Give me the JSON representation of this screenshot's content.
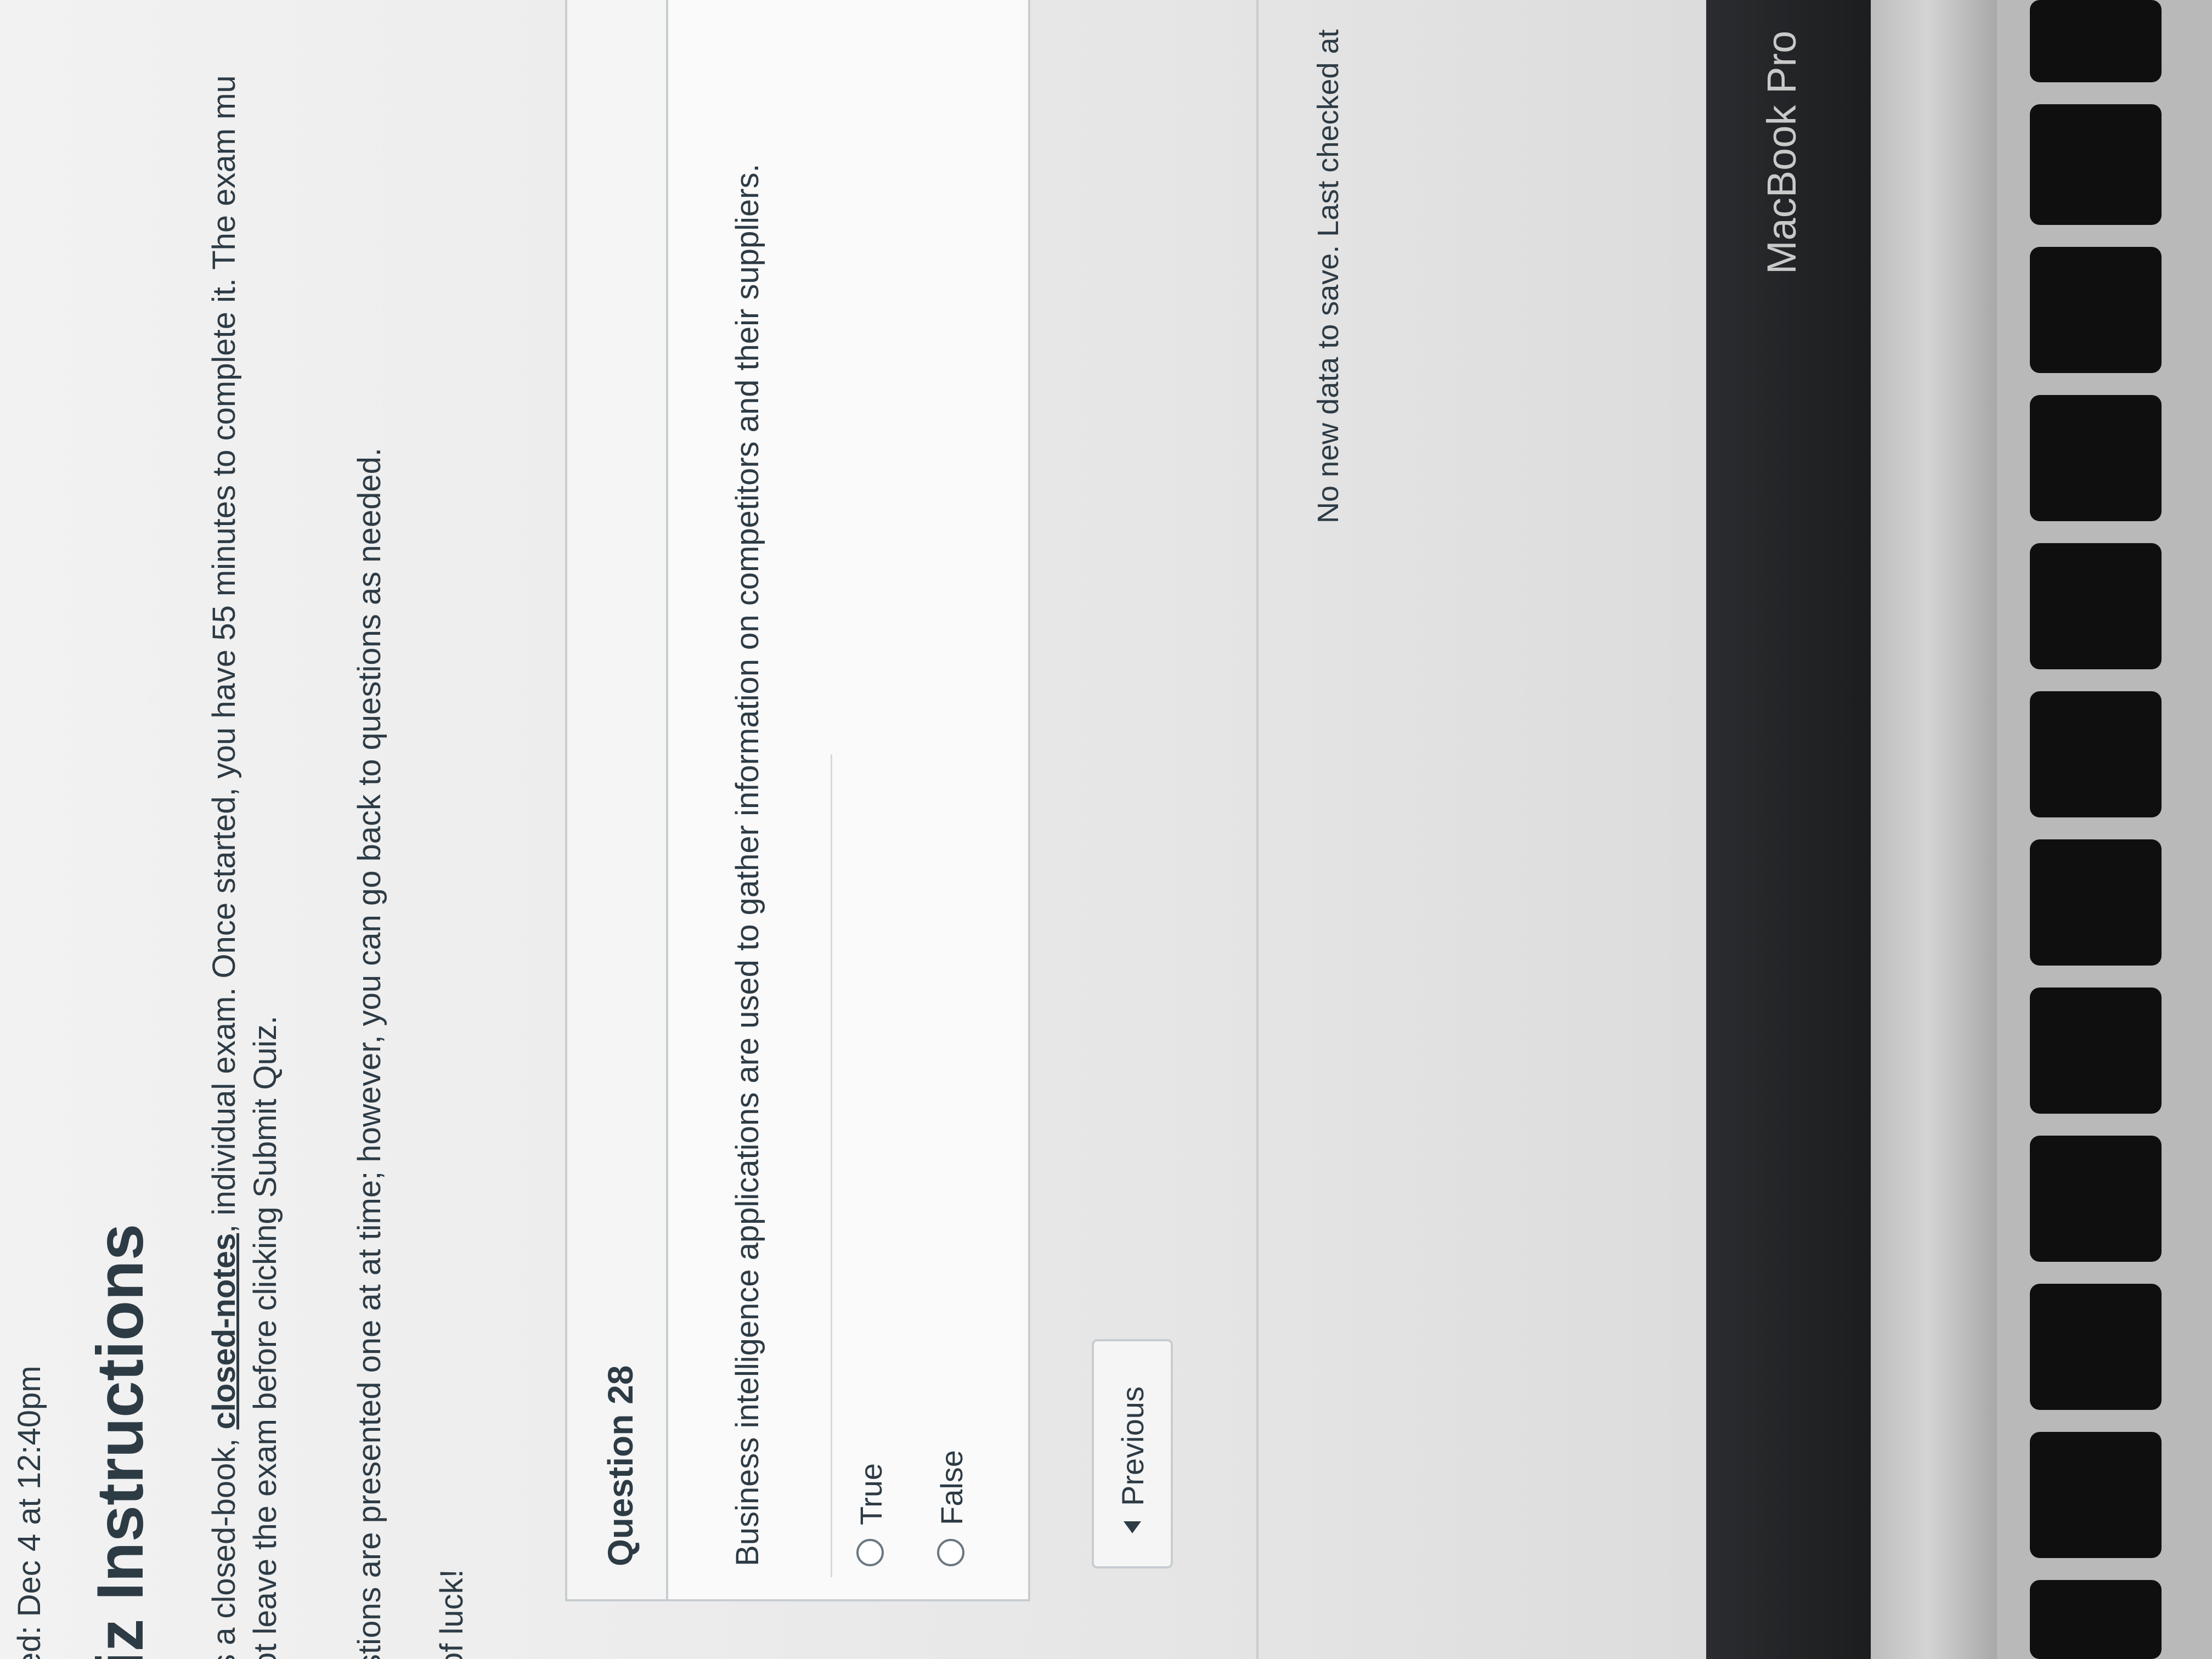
{
  "header": {
    "due_line": "ed: Dec 4 at 12:40pm",
    "page_title": "iz Instructions"
  },
  "instructions": {
    "line1_prefix": "s a closed-book, ",
    "line1_emphasis": "closed-notes",
    "line1_suffix": ", individual exam. Once started, you have 55 minutes to complete it. The exam mu",
    "line2": "ot leave the exam before clicking Submit Quiz.",
    "line3": "stions are presented one at at time; however, you can go back to questions as needed.",
    "line4": "of luck!"
  },
  "question": {
    "title": "Question 28",
    "text": "Business intelligence applications are used to gather information on competitors and their suppliers.",
    "options": [
      {
        "label": "True"
      },
      {
        "label": "False"
      }
    ]
  },
  "navigation": {
    "previous_label": "Previous"
  },
  "status": {
    "save_message": "No new data to save. Last checked at"
  },
  "device": {
    "label": "MacBook Pro"
  }
}
